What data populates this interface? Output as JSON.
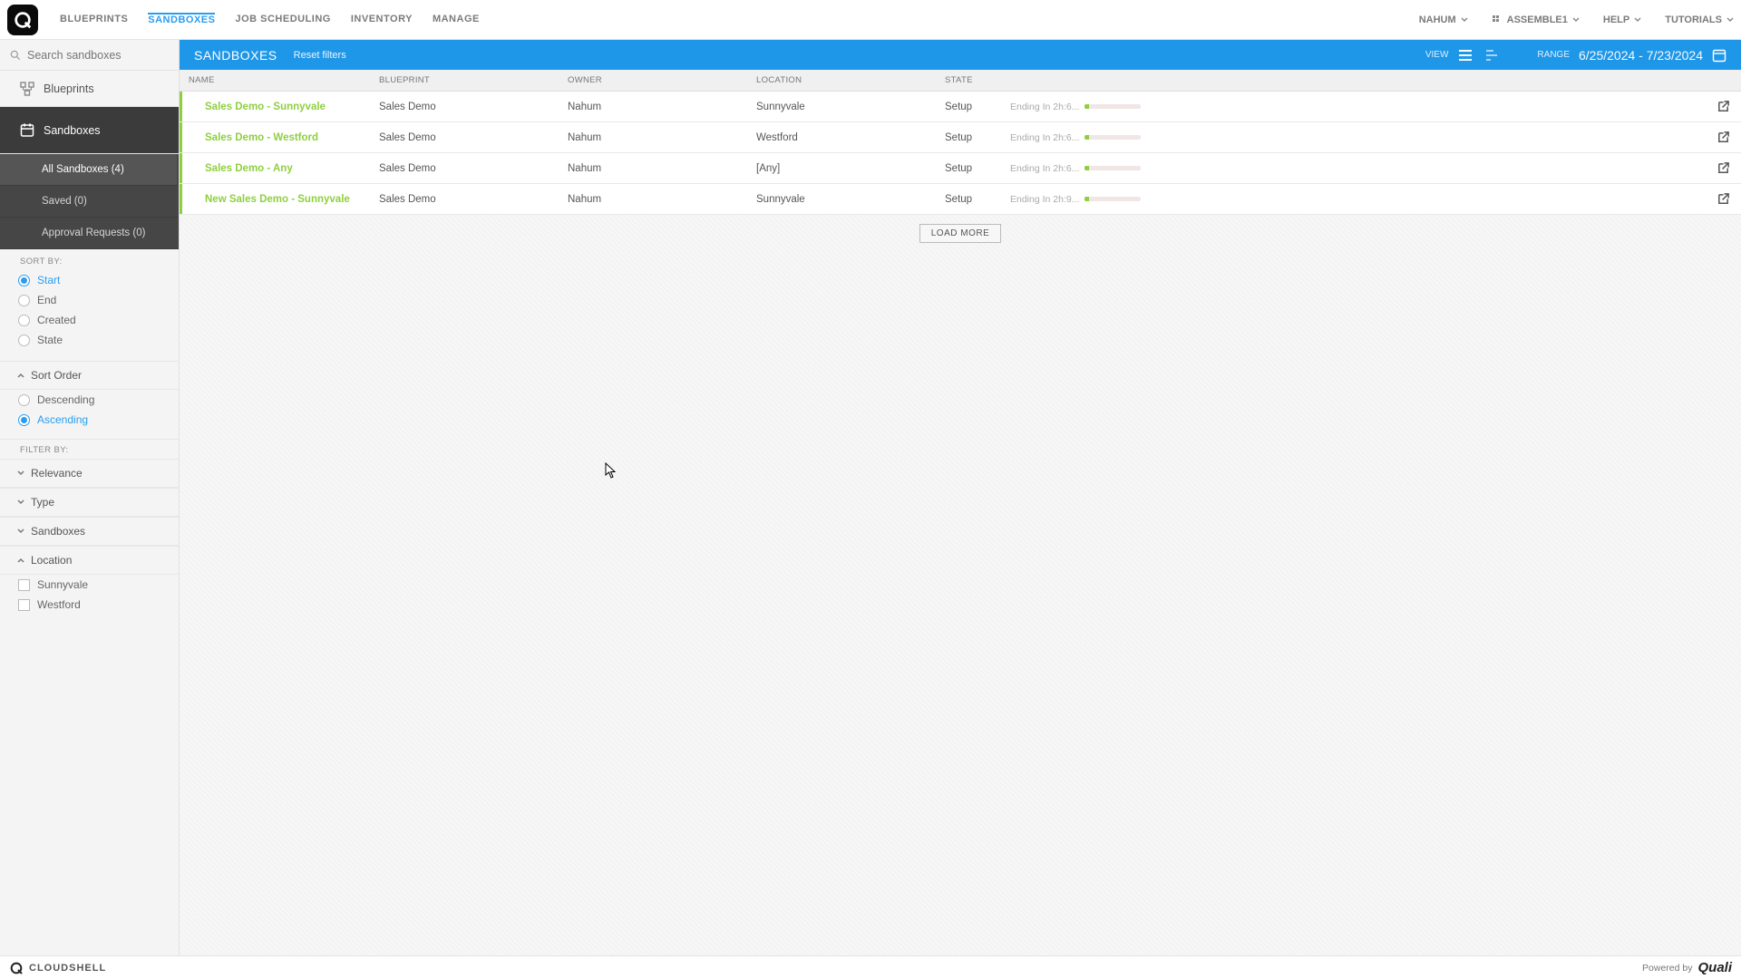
{
  "topnav": {
    "items": [
      "BLUEPRINTS",
      "SANDBOXES",
      "JOB SCHEDULING",
      "INVENTORY",
      "MANAGE"
    ],
    "activeIndex": 1
  },
  "topright": {
    "user": "NAHUM",
    "org": "ASSEMBLE1",
    "help": "HELP",
    "tutorials": "TUTORIALS"
  },
  "search": {
    "placeholder": "Search sandboxes"
  },
  "sidebar": {
    "blueprints": "Blueprints",
    "sandboxes": "Sandboxes",
    "sub": {
      "all": "All Sandboxes (4)",
      "saved": "Saved (0)",
      "approval": "Approval Requests (0)"
    },
    "sortby_label": "SORT BY:",
    "sort_options": [
      "Start",
      "End",
      "Created",
      "State"
    ],
    "sort_selected": 0,
    "sort_order_label": "Sort Order",
    "sort_order_options": [
      "Descending",
      "Ascending"
    ],
    "sort_order_selected": 1,
    "filterby_label": "FILTER BY:",
    "filters": {
      "relevance": "Relevance",
      "type": "Type",
      "sandboxes": "Sandboxes",
      "location": "Location",
      "locations": [
        "Sunnyvale",
        "Westford"
      ]
    }
  },
  "bluebar": {
    "title": "SANDBOXES",
    "reset": "Reset filters",
    "view": "VIEW",
    "range_label": "RANGE",
    "range_value": "6/25/2024 - 7/23/2024"
  },
  "columns": {
    "name": "NAME",
    "blueprint": "BLUEPRINT",
    "owner": "OWNER",
    "location": "LOCATION",
    "state": "STATE"
  },
  "rows": [
    {
      "name": "Sales Demo - Sunnyvale",
      "blueprint": "Sales Demo",
      "owner": "Nahum",
      "location": "Sunnyvale",
      "state": "Setup",
      "ending": "Ending In 2h:6..."
    },
    {
      "name": "Sales Demo - Westford",
      "blueprint": "Sales Demo",
      "owner": "Nahum",
      "location": "Westford",
      "state": "Setup",
      "ending": "Ending In 2h:6..."
    },
    {
      "name": "Sales Demo - Any",
      "blueprint": "Sales Demo",
      "owner": "Nahum",
      "location": "[Any]",
      "state": "Setup",
      "ending": "Ending In 2h:6..."
    },
    {
      "name": "New Sales Demo - Sunnyvale",
      "blueprint": "Sales Demo",
      "owner": "Nahum",
      "location": "Sunnyvale",
      "state": "Setup",
      "ending": "Ending In 2h:9..."
    }
  ],
  "loadmore": "LOAD MORE",
  "footer": {
    "brand": "CLOUDSHELL",
    "powered": "Powered by",
    "company": "Quali"
  }
}
